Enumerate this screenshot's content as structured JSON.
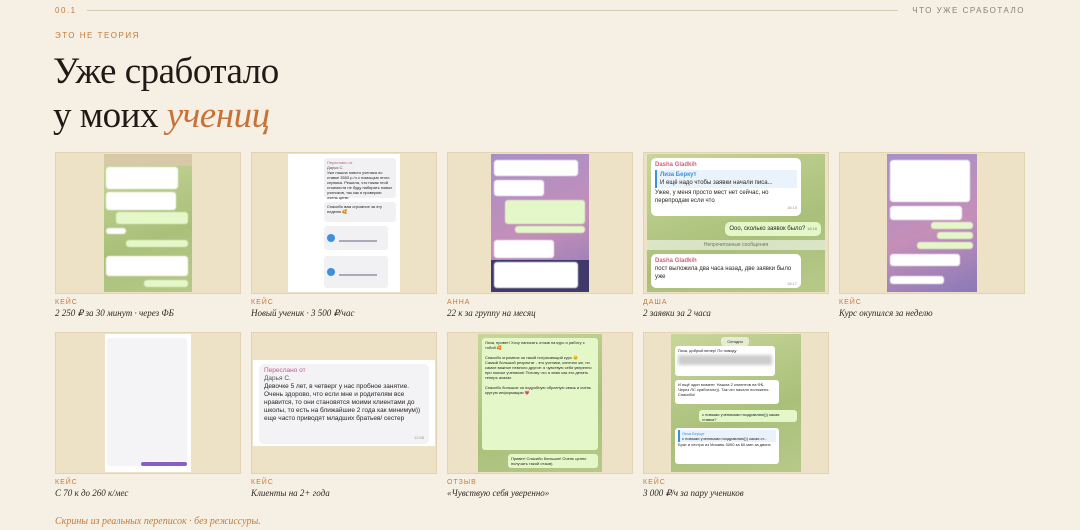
{
  "topbar": {
    "num": "00.1",
    "label": "ЧТО УЖЕ СРАБОТАЛО"
  },
  "eyebrow": "ЭТО НЕ ТЕОРИЯ",
  "title": {
    "line1": "Уже сработало",
    "line2_prefix": "у моих ",
    "line2_accent": "учениц"
  },
  "cards": [
    {
      "tag": "КЕЙС",
      "caption": "2 250 ₽ за 30 минут · через ФБ"
    },
    {
      "tag": "КЕЙС",
      "caption": "Новый ученик · 3 500 ₽/час"
    },
    {
      "tag": "АННА",
      "caption": "22 к за группу на месяц"
    },
    {
      "tag": "ДАША",
      "caption": "2 заявки за 2 часа"
    },
    {
      "tag": "КЕЙС",
      "caption": "Курс окупился за неделю"
    },
    {
      "tag": "КЕЙС",
      "caption": "С 70 к до 260 к/мес"
    },
    {
      "tag": "КЕЙС",
      "caption": "Клиенты на 2+ года"
    },
    {
      "tag": "ОТЗЫВ",
      "caption": "«Чувствую себя уверенно»"
    },
    {
      "tag": "КЕЙС",
      "caption": "3 000 ₽/ч за пару учеников"
    }
  ],
  "shots": {
    "s2": {
      "fwd": "Переслано от",
      "name": "Дарья С.",
      "msg": "Уже нашла нового ученика по ставке 3500 р./ч с помощью этого сервиса. Решила, что никак этой стоимости не буду набирать новых учеников, так как я проверяю очень ценю",
      "msg2": "Спасибо вам огромное за эту неделю 🥰"
    },
    "s4": {
      "name": "Dasha Gladkih",
      "quote_name": "Лиза Беркут",
      "quote": "И ещё надо чтобы заявки начали писа...",
      "msg1": "Ужее, у меня просто мест нет сейчас, но перепродам если что",
      "time1": "18:15",
      "reply": "Ооо, сколько заявок было?",
      "time2": "18:16",
      "divider": "Непрочитанные сообщения",
      "msg2": "пост выложила два часа назад, две заявки было уже",
      "time3": "18:17"
    },
    "s7": {
      "fwd": "Переслано от",
      "name": "Дарья С.",
      "msg": "Девочке 5 лет, в четверг у нас пробное занятие. Очень здорово, что если мне и родителям все нравится, то они становятся моими клиентами до школы, то есть на ближайшие 2 года как минимум)) еще часто приводят младших братьев/ сестер",
      "time": "12:58"
    },
    "s8": {
      "msg": "Лиза, привет! Хочу написать отзыв на курс и работу с тобой 🥰\n\nСпасибо огромное за такой потрясающий курс 😊\nСамый большой результат - это ученики, конечно же, но самое важное немного другое: я чувствую себя уверенно при поиске учеников! Потому что я знаю как это делать теперь ахахах\n\nСпасибо большое за подробную обратную связь и очень крутую информацию 💗",
      "reply": "Привет! Спасибо большое! Очень ценно получать такой отзыв)"
    },
    "s9": {
      "date": "Сегодня",
      "msg": "Лиза, добрый вечер! По поводу",
      "msg2": "И ещё один момент. Нашла 2 клиентов на ФБ. Через ЛС сработало)). Так что начало положено. Спасибо!",
      "reply": "с новыми учениками поздравляю))) какая ставка?",
      "quote_name": "Лиза Беркут",
      "quote": "с новыми учениками поздравляю))) какая ст...",
      "msg3": "Брат и сестра из Москвы 3000 за 60 мин за двоих"
    }
  },
  "footnote": "Скрины из реальных переписок · без режиссуры."
}
